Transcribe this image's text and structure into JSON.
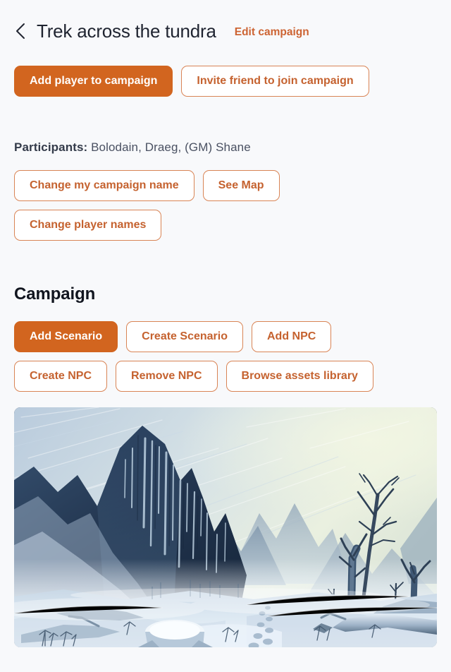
{
  "theme": {
    "accent": "#d2651f",
    "accent_outline": "#c5622f",
    "accent_border": "#d98455",
    "page_bg": "#f8f9fb",
    "title_color": "#1f2430",
    "body_text": "#4a5162"
  },
  "header": {
    "back_icon": "chevron-left-icon",
    "title": "Trek across the tundra",
    "edit_link": "Edit campaign"
  },
  "actions": {
    "add_player": "Add player to campaign",
    "invite_friend": "Invite friend to join campaign"
  },
  "participants": {
    "label": "Participants:",
    "names": "Bolodain, Draeg, (GM) Shane",
    "buttons": {
      "change_my_campaign_name": "Change my campaign name",
      "see_map": "See Map",
      "change_player_names": "Change player names"
    }
  },
  "campaign": {
    "heading": "Campaign",
    "buttons": {
      "add_scenario": "Add Scenario",
      "create_scenario": "Create Scenario",
      "add_npc": "Add NPC",
      "create_npc": "Create NPC",
      "remove_npc": "Remove NPC",
      "browse_assets_library": "Browse assets library"
    }
  },
  "scene": {
    "name": "frozen-tundra-blizzard-illustration",
    "alt": "Snow-covered tundra under a blizzard with icy cliffs, distant mountains, bare dead trees and footprints in the snow",
    "sky_color": "#e8efe4",
    "ice_color": "#2c4566",
    "snow_color": "#dfe9f3"
  }
}
